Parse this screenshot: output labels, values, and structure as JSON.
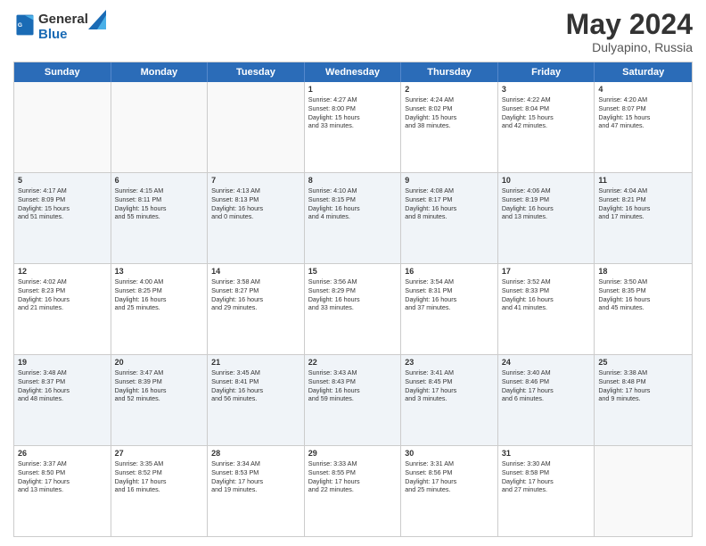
{
  "header": {
    "logo_general": "General",
    "logo_blue": "Blue",
    "month": "May 2024",
    "location": "Dulyapino, Russia"
  },
  "days_of_week": [
    "Sunday",
    "Monday",
    "Tuesday",
    "Wednesday",
    "Thursday",
    "Friday",
    "Saturday"
  ],
  "weeks": [
    [
      {
        "day": "",
        "text": ""
      },
      {
        "day": "",
        "text": ""
      },
      {
        "day": "",
        "text": ""
      },
      {
        "day": "1",
        "text": "Sunrise: 4:27 AM\nSunset: 8:00 PM\nDaylight: 15 hours\nand 33 minutes."
      },
      {
        "day": "2",
        "text": "Sunrise: 4:24 AM\nSunset: 8:02 PM\nDaylight: 15 hours\nand 38 minutes."
      },
      {
        "day": "3",
        "text": "Sunrise: 4:22 AM\nSunset: 8:04 PM\nDaylight: 15 hours\nand 42 minutes."
      },
      {
        "day": "4",
        "text": "Sunrise: 4:20 AM\nSunset: 8:07 PM\nDaylight: 15 hours\nand 47 minutes."
      }
    ],
    [
      {
        "day": "5",
        "text": "Sunrise: 4:17 AM\nSunset: 8:09 PM\nDaylight: 15 hours\nand 51 minutes."
      },
      {
        "day": "6",
        "text": "Sunrise: 4:15 AM\nSunset: 8:11 PM\nDaylight: 15 hours\nand 55 minutes."
      },
      {
        "day": "7",
        "text": "Sunrise: 4:13 AM\nSunset: 8:13 PM\nDaylight: 16 hours\nand 0 minutes."
      },
      {
        "day": "8",
        "text": "Sunrise: 4:10 AM\nSunset: 8:15 PM\nDaylight: 16 hours\nand 4 minutes."
      },
      {
        "day": "9",
        "text": "Sunrise: 4:08 AM\nSunset: 8:17 PM\nDaylight: 16 hours\nand 8 minutes."
      },
      {
        "day": "10",
        "text": "Sunrise: 4:06 AM\nSunset: 8:19 PM\nDaylight: 16 hours\nand 13 minutes."
      },
      {
        "day": "11",
        "text": "Sunrise: 4:04 AM\nSunset: 8:21 PM\nDaylight: 16 hours\nand 17 minutes."
      }
    ],
    [
      {
        "day": "12",
        "text": "Sunrise: 4:02 AM\nSunset: 8:23 PM\nDaylight: 16 hours\nand 21 minutes."
      },
      {
        "day": "13",
        "text": "Sunrise: 4:00 AM\nSunset: 8:25 PM\nDaylight: 16 hours\nand 25 minutes."
      },
      {
        "day": "14",
        "text": "Sunrise: 3:58 AM\nSunset: 8:27 PM\nDaylight: 16 hours\nand 29 minutes."
      },
      {
        "day": "15",
        "text": "Sunrise: 3:56 AM\nSunset: 8:29 PM\nDaylight: 16 hours\nand 33 minutes."
      },
      {
        "day": "16",
        "text": "Sunrise: 3:54 AM\nSunset: 8:31 PM\nDaylight: 16 hours\nand 37 minutes."
      },
      {
        "day": "17",
        "text": "Sunrise: 3:52 AM\nSunset: 8:33 PM\nDaylight: 16 hours\nand 41 minutes."
      },
      {
        "day": "18",
        "text": "Sunrise: 3:50 AM\nSunset: 8:35 PM\nDaylight: 16 hours\nand 45 minutes."
      }
    ],
    [
      {
        "day": "19",
        "text": "Sunrise: 3:48 AM\nSunset: 8:37 PM\nDaylight: 16 hours\nand 48 minutes."
      },
      {
        "day": "20",
        "text": "Sunrise: 3:47 AM\nSunset: 8:39 PM\nDaylight: 16 hours\nand 52 minutes."
      },
      {
        "day": "21",
        "text": "Sunrise: 3:45 AM\nSunset: 8:41 PM\nDaylight: 16 hours\nand 56 minutes."
      },
      {
        "day": "22",
        "text": "Sunrise: 3:43 AM\nSunset: 8:43 PM\nDaylight: 16 hours\nand 59 minutes."
      },
      {
        "day": "23",
        "text": "Sunrise: 3:41 AM\nSunset: 8:45 PM\nDaylight: 17 hours\nand 3 minutes."
      },
      {
        "day": "24",
        "text": "Sunrise: 3:40 AM\nSunset: 8:46 PM\nDaylight: 17 hours\nand 6 minutes."
      },
      {
        "day": "25",
        "text": "Sunrise: 3:38 AM\nSunset: 8:48 PM\nDaylight: 17 hours\nand 9 minutes."
      }
    ],
    [
      {
        "day": "26",
        "text": "Sunrise: 3:37 AM\nSunset: 8:50 PM\nDaylight: 17 hours\nand 13 minutes."
      },
      {
        "day": "27",
        "text": "Sunrise: 3:35 AM\nSunset: 8:52 PM\nDaylight: 17 hours\nand 16 minutes."
      },
      {
        "day": "28",
        "text": "Sunrise: 3:34 AM\nSunset: 8:53 PM\nDaylight: 17 hours\nand 19 minutes."
      },
      {
        "day": "29",
        "text": "Sunrise: 3:33 AM\nSunset: 8:55 PM\nDaylight: 17 hours\nand 22 minutes."
      },
      {
        "day": "30",
        "text": "Sunrise: 3:31 AM\nSunset: 8:56 PM\nDaylight: 17 hours\nand 25 minutes."
      },
      {
        "day": "31",
        "text": "Sunrise: 3:30 AM\nSunset: 8:58 PM\nDaylight: 17 hours\nand 27 minutes."
      },
      {
        "day": "",
        "text": ""
      }
    ]
  ]
}
